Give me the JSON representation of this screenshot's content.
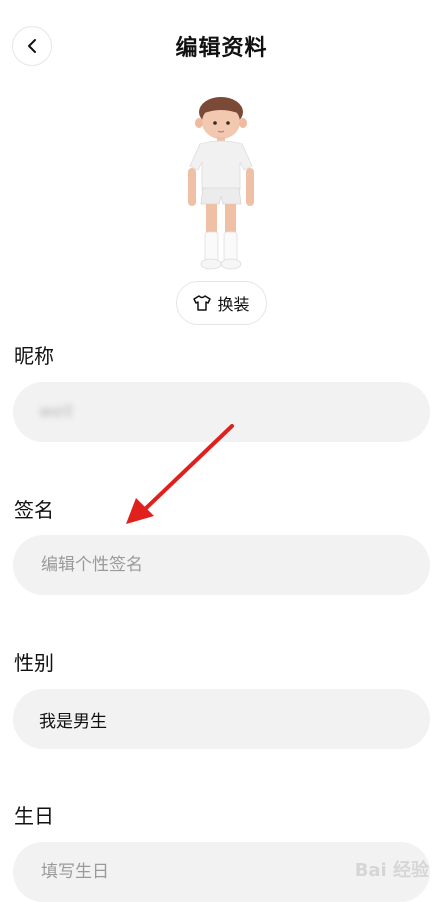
{
  "header": {
    "title": "编辑资料"
  },
  "outfit_button": {
    "label": "换装"
  },
  "nickname": {
    "label": "昵称",
    "value": "well"
  },
  "signature": {
    "label": "签名",
    "placeholder": "编辑个性签名"
  },
  "gender": {
    "label": "性别",
    "value": "我是男生"
  },
  "birthday": {
    "label": "生日",
    "placeholder": "填写生日"
  },
  "colors": {
    "field_bg": "#f2f2f2",
    "annotation_arrow": "#e0201c"
  },
  "watermark": {
    "text": "Bai 经验"
  }
}
